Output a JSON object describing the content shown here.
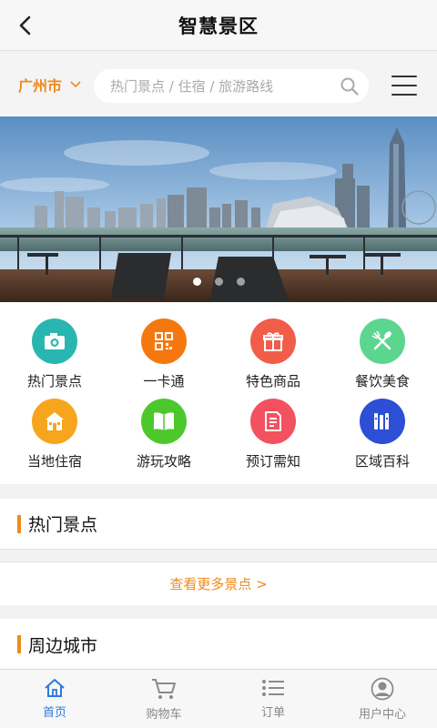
{
  "header": {
    "title": "智慧景区"
  },
  "search": {
    "city": "广州市",
    "placeholder": "热门景点 / 住宿 / 旅游路线"
  },
  "banner": {
    "slide_count": 3,
    "active_slide": 1
  },
  "grid": {
    "items": [
      {
        "label": "热门景点",
        "icon": "camera-icon",
        "color": "#2ab6b0"
      },
      {
        "label": "一卡通",
        "icon": "qr-card-icon",
        "color": "#f5780f"
      },
      {
        "label": "特色商品",
        "icon": "gift-icon",
        "color": "#f25d4a"
      },
      {
        "label": "餐饮美食",
        "icon": "fork-spoon-icon",
        "color": "#5cd68f"
      },
      {
        "label": "当地住宿",
        "icon": "house-icon",
        "color": "#f7a51d"
      },
      {
        "label": "游玩攻略",
        "icon": "book-icon",
        "color": "#4cc82c"
      },
      {
        "label": "预订需知",
        "icon": "document-icon",
        "color": "#f2525f"
      },
      {
        "label": "区域百科",
        "icon": "library-icon",
        "color": "#2d4fd6"
      }
    ]
  },
  "sections": {
    "hot": {
      "title": "热门景点",
      "more": "查看更多景点 >"
    },
    "nearby": {
      "title": "周边城市"
    }
  },
  "nav": {
    "items": [
      {
        "label": "首页",
        "icon": "home-icon",
        "active": true
      },
      {
        "label": "购物车",
        "icon": "cart-icon",
        "active": false
      },
      {
        "label": "订单",
        "icon": "list-icon",
        "active": false
      },
      {
        "label": "用户中心",
        "icon": "user-icon",
        "active": false
      }
    ]
  },
  "colors": {
    "accent": "#f08a1d",
    "nav_active": "#2f7ad9"
  }
}
